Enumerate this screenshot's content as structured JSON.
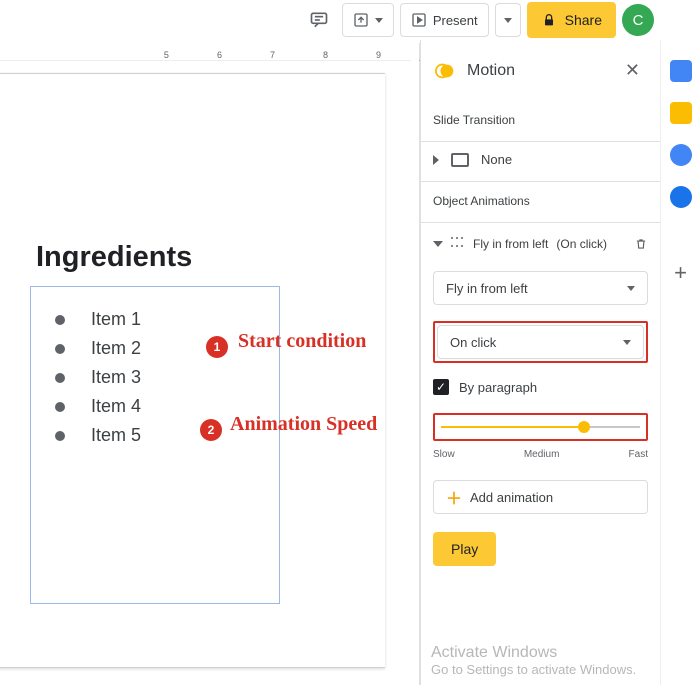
{
  "toolbar": {
    "comment_icon": "comment-icon",
    "present": "Present",
    "share": "Share",
    "avatar_initial": "C"
  },
  "ruler": {
    "ticks": [
      "5",
      "6",
      "7",
      "8",
      "9"
    ]
  },
  "slide": {
    "title": "Ingredients",
    "items": [
      "Item 1",
      "Item 2",
      "Item 3",
      "Item 4",
      "Item 5"
    ]
  },
  "annotations": {
    "one": "1",
    "one_label": "Start condition",
    "two": "2",
    "two_label": "Animation Speed"
  },
  "motion": {
    "panel_title": "Motion",
    "slide_transition_label": "Slide Transition",
    "transition_none": "None",
    "object_animations_label": "Object Animations",
    "current_anim_name": "Fly in from left",
    "current_anim_mode": "(On click)",
    "effect_dropdown": "Fly in from left",
    "start_dropdown": "On click",
    "by_paragraph": "By paragraph",
    "speed_labels": {
      "slow": "Slow",
      "medium": "Medium",
      "fast": "Fast"
    },
    "speed_percent": 72,
    "add_animation": "Add animation",
    "play": "Play"
  },
  "watermark": {
    "title": "Activate Windows",
    "sub": "Go to Settings to activate Windows."
  }
}
